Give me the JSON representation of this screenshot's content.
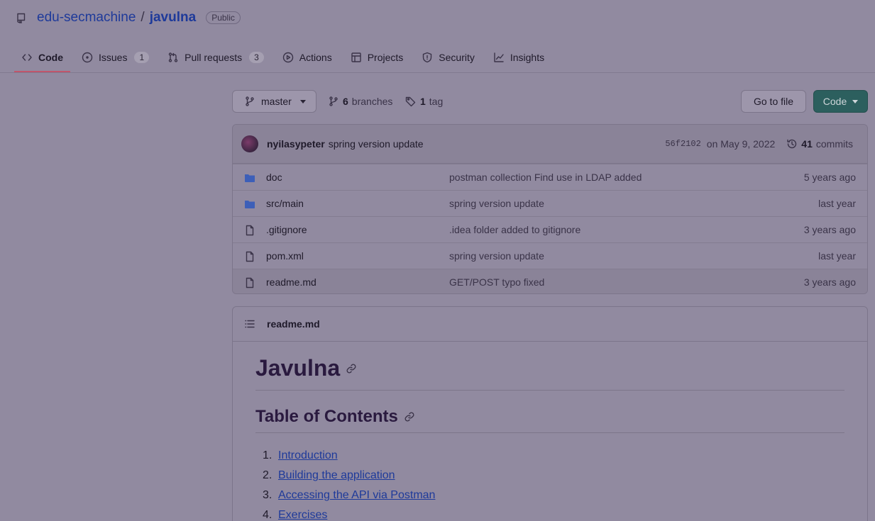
{
  "repo": {
    "owner": "edu-secmachine",
    "separator": "/",
    "name": "javulna",
    "visibility": "Public"
  },
  "tabs": [
    {
      "label": "Code",
      "icon": "code-icon",
      "active": true
    },
    {
      "label": "Issues",
      "icon": "issue-icon",
      "count": "1"
    },
    {
      "label": "Pull requests",
      "icon": "pull-request-icon",
      "count": "3"
    },
    {
      "label": "Actions",
      "icon": "play-icon"
    },
    {
      "label": "Projects",
      "icon": "table-icon"
    },
    {
      "label": "Security",
      "icon": "shield-icon"
    },
    {
      "label": "Insights",
      "icon": "graph-icon"
    }
  ],
  "branch_bar": {
    "branch": "master",
    "branches_count": "6",
    "branches_label": "branches",
    "tags_count": "1",
    "tags_label": "tag",
    "goto_file": "Go to file",
    "code_button": "Code"
  },
  "latest_commit": {
    "author": "nyilasypeter",
    "message": "spring version update",
    "sha": "56f2102",
    "date": "on May 9, 2022",
    "commits_count": "41",
    "commits_label": "commits"
  },
  "files": [
    {
      "type": "folder",
      "name": "doc",
      "message": "postman collection Find use in LDAP added",
      "age": "5 years ago"
    },
    {
      "type": "folder",
      "name": "src/main",
      "message": "spring version update",
      "age": "last year"
    },
    {
      "type": "file",
      "name": ".gitignore",
      "message": ".idea folder added to gitignore",
      "age": "3 years ago"
    },
    {
      "type": "file",
      "name": "pom.xml",
      "message": "spring version update",
      "age": "last year"
    },
    {
      "type": "file",
      "name": "readme.md",
      "message": "GET/POST typo fixed",
      "age": "3 years ago"
    }
  ],
  "readme": {
    "filename": "readme.md",
    "title": "Javulna",
    "toc_heading": "Table of Contents",
    "toc": [
      {
        "num": "1.",
        "label": "Introduction"
      },
      {
        "num": "2.",
        "label": "Building the application"
      },
      {
        "num": "3.",
        "label": "Accessing the API via Postman"
      },
      {
        "num": "4.",
        "label": "Exercises"
      }
    ]
  },
  "colors": {
    "overlay_background": "#918aa0",
    "link": "#1e3a9a",
    "folder": "#3d5fb8",
    "code_button": "#2c5f5e",
    "active_tab_underline": "#c0566b"
  }
}
